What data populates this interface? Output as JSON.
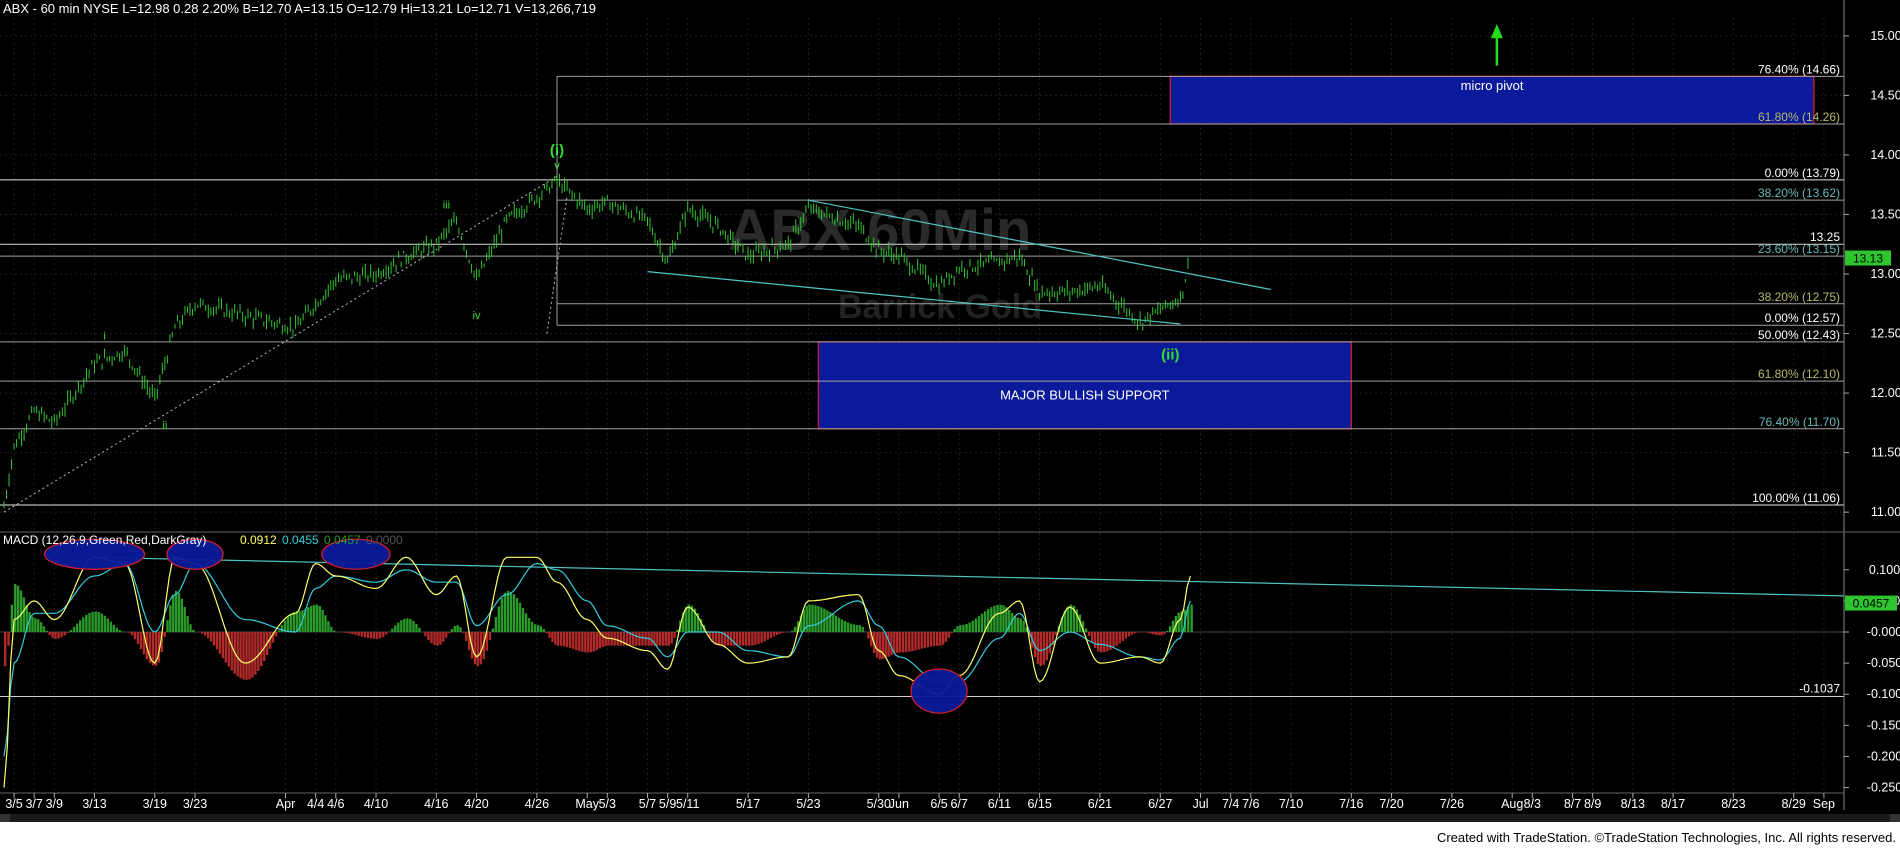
{
  "header": {
    "symbol_line": "ABX - 60 min  NYSE  L=12.98  0.28  2.20%  B=12.70  A=13.15  O=12.79  Hi=13.21  Lo=12.71  V=13,266,719",
    "watermark_main": "ABX 60Min",
    "watermark_sub": "Barrick Gold"
  },
  "colors": {
    "background": "#000000",
    "price_bars": "#35c435",
    "hline": "#cfcfcf",
    "box_fill": "#0a1a9a",
    "box_border": "#d01e2a",
    "trendline": "#4fc4c4",
    "macd_line": "#ffff66",
    "signal_line": "#33ccdd",
    "hist_pos": "#2a9a2a",
    "hist_neg": "#b22a2a",
    "green_label": "#33dd33",
    "ellipse_fill": "#0a1a9a"
  },
  "chart_data": {
    "type": "line",
    "price_panel": {
      "ylim": [
        10.85,
        15.15
      ],
      "y_ticks": [
        "15.00",
        "14.50",
        "14.00",
        "13.50",
        "13.00",
        "12.50",
        "12.00",
        "11.50",
        "11.00"
      ],
      "last_price_tag": "13.13",
      "series": [
        {
          "x": [
            "3/4",
            "3/5",
            "3/7",
            "3/9",
            "3/13",
            "3/16",
            "3/19",
            "3/21",
            "3/23",
            "3/28",
            "4/2",
            "4/4",
            "4/6",
            "4/10",
            "4/13",
            "4/16",
            "4/18",
            "4/20",
            "4/23",
            "4/26",
            "4/28",
            "5/1",
            "5/3",
            "5/7",
            "5/9",
            "5/11",
            "5/14",
            "5/17",
            "5/21",
            "5/23",
            "5/28",
            "5/30",
            "6/1",
            "6/5",
            "6/7",
            "6/11",
            "6/13",
            "6/15",
            "6/18",
            "6/21",
            "6/25",
            "6/27",
            "6/29",
            "6/30"
          ],
          "values": [
            11.05,
            11.55,
            11.85,
            11.75,
            12.25,
            12.35,
            11.95,
            12.55,
            12.75,
            12.65,
            12.55,
            12.75,
            12.95,
            13.0,
            13.15,
            13.25,
            13.45,
            12.95,
            13.45,
            13.65,
            13.78,
            13.55,
            13.6,
            13.45,
            13.1,
            13.55,
            13.4,
            13.15,
            13.25,
            13.55,
            13.4,
            13.2,
            13.15,
            12.9,
            13.05,
            13.1,
            13.15,
            12.85,
            12.85,
            12.9,
            12.6,
            12.7,
            12.8,
            13.13
          ]
        }
      ],
      "fib_levels": [
        {
          "label": "76.40% (14.66)",
          "value": 14.66
        },
        {
          "label": "61.80% (14.26)",
          "value": 14.26
        },
        {
          "label": "0.00% (13.79)",
          "value": 13.79
        },
        {
          "label": "38.20% (13.62)",
          "value": 13.62
        },
        {
          "label": "13.25",
          "value": 13.25
        },
        {
          "label": "23.60% (13.15)",
          "value": 13.15
        },
        {
          "label": "38.20% (12.75)",
          "value": 12.75
        },
        {
          "label": "0.00% (12.57)",
          "value": 12.57
        },
        {
          "label": "50.00% (12.43)",
          "value": 12.43
        },
        {
          "label": "61.80% (12.10)",
          "value": 12.1
        },
        {
          "label": "76.40% (11.70)",
          "value": 11.7
        },
        {
          "label": "100.00% (11.06)",
          "value": 11.06
        }
      ],
      "boxes": [
        {
          "label": "micro pivot",
          "x_from": "6/28",
          "x_to": "8/31",
          "y_from": 14.26,
          "y_to": 14.66
        },
        {
          "label": "MAJOR BULLISH SUPPORT",
          "x_from": "5/24",
          "x_to": "7/16",
          "y_from": 11.7,
          "y_to": 12.43
        }
      ],
      "wave_labels": [
        {
          "text": "(i)",
          "x": "4/28",
          "y": 14.0,
          "color": "green"
        },
        {
          "text": "v",
          "x": "4/28",
          "y": 13.88,
          "color": "green"
        },
        {
          "text": "iii",
          "x": "4/17",
          "y": 13.55,
          "color": "green"
        },
        {
          "text": "iv",
          "x": "4/20",
          "y": 12.62,
          "color": "green"
        },
        {
          "text": "i",
          "x": "3/14",
          "y": 12.45,
          "color": "green"
        },
        {
          "text": "ii",
          "x": "3/20",
          "y": 11.7,
          "color": "green"
        },
        {
          "text": "(ii)",
          "x": "6/28",
          "y": 12.28,
          "color": "green"
        }
      ]
    },
    "macd_panel": {
      "title": "MACD (12,26,9,Green,Red,DarkGray)",
      "readouts": [
        "0.0912",
        "0.0455",
        "0.0457",
        "0.0000"
      ],
      "ylim": [
        -0.27,
        0.135
      ],
      "y_ticks": [
        "0.1000",
        "0.0500",
        "-0.0000",
        "-0.0500",
        "-0.1000",
        "-0.1500",
        "-0.2000",
        "-0.2500"
      ],
      "last_value_tag": "0.0457",
      "support_label": "-0.1037",
      "support_value": -0.1037,
      "series": [
        {
          "name": "MACD",
          "x": [
            "3/4",
            "3/5",
            "3/7",
            "3/9",
            "3/13",
            "3/16",
            "3/19",
            "3/21",
            "3/23",
            "3/28",
            "4/2",
            "4/4",
            "4/6",
            "4/10",
            "4/13",
            "4/16",
            "4/18",
            "4/20",
            "4/23",
            "4/26",
            "4/28",
            "5/1",
            "5/3",
            "5/7",
            "5/9",
            "5/11",
            "5/14",
            "5/17",
            "5/21",
            "5/23",
            "5/28",
            "5/30",
            "6/1",
            "6/5",
            "6/7",
            "6/11",
            "6/13",
            "6/15",
            "6/18",
            "6/21",
            "6/25",
            "6/27",
            "6/29",
            "6/30"
          ],
          "values": [
            -0.25,
            0.02,
            0.05,
            0.02,
            0.12,
            0.11,
            -0.05,
            0.12,
            0.11,
            -0.05,
            0.03,
            0.11,
            0.09,
            0.07,
            0.12,
            0.06,
            0.09,
            -0.04,
            0.12,
            0.12,
            0.08,
            0.02,
            -0.01,
            -0.03,
            -0.06,
            0.04,
            -0.02,
            -0.05,
            -0.04,
            0.05,
            0.06,
            -0.03,
            -0.07,
            -0.1,
            -0.07,
            0.03,
            0.05,
            -0.08,
            0.04,
            -0.05,
            -0.04,
            -0.05,
            0.02,
            0.09
          ]
        },
        {
          "name": "Signal",
          "x": [
            "3/4",
            "3/5",
            "3/7",
            "3/9",
            "3/13",
            "3/16",
            "3/19",
            "3/21",
            "3/23",
            "3/28",
            "4/2",
            "4/4",
            "4/6",
            "4/10",
            "4/13",
            "4/16",
            "4/18",
            "4/20",
            "4/23",
            "4/26",
            "4/28",
            "5/1",
            "5/3",
            "5/7",
            "5/9",
            "5/11",
            "5/14",
            "5/17",
            "5/21",
            "5/23",
            "5/28",
            "5/30",
            "6/1",
            "6/5",
            "6/7",
            "6/11",
            "6/13",
            "6/15",
            "6/18",
            "6/21",
            "6/25",
            "6/27",
            "6/29",
            "6/30"
          ],
          "values": [
            -0.2,
            -0.05,
            0.03,
            0.03,
            0.09,
            0.11,
            0.0,
            0.06,
            0.11,
            0.02,
            0.0,
            0.07,
            0.09,
            0.08,
            0.1,
            0.08,
            0.08,
            0.01,
            0.06,
            0.11,
            0.1,
            0.05,
            0.01,
            -0.01,
            -0.04,
            0.0,
            0.0,
            -0.03,
            -0.04,
            0.01,
            0.05,
            0.01,
            -0.04,
            -0.08,
            -0.08,
            -0.01,
            0.03,
            -0.03,
            0.0,
            -0.02,
            -0.04,
            -0.045,
            -0.01,
            0.05
          ]
        }
      ],
      "highlight_ellipses": [
        "3/13",
        "3/23",
        "4/8",
        "6/5"
      ]
    },
    "x_axis": {
      "tick_labels": [
        "3/5",
        "3/7",
        "3/9",
        "3/13",
        "3/19",
        "3/23",
        "Apr",
        "4/4",
        "4/6",
        "4/10",
        "4/16",
        "4/20",
        "4/26",
        "May",
        "5/3",
        "5/7",
        "5/9",
        "5/11",
        "5/17",
        "5/23",
        "5/30",
        "Jun",
        "6/5",
        "6/7",
        "6/11",
        "6/15",
        "6/21",
        "6/27",
        "Jul",
        "7/4",
        "7/6",
        "7/10",
        "7/16",
        "7/20",
        "7/26",
        "Aug",
        "8/3",
        "8/7",
        "8/9",
        "8/13",
        "8/17",
        "8/23",
        "8/29",
        "Sep"
      ]
    }
  },
  "footer": {
    "credit": "Created with TradeStation. ©TradeStation Technologies, Inc. All rights reserved."
  }
}
